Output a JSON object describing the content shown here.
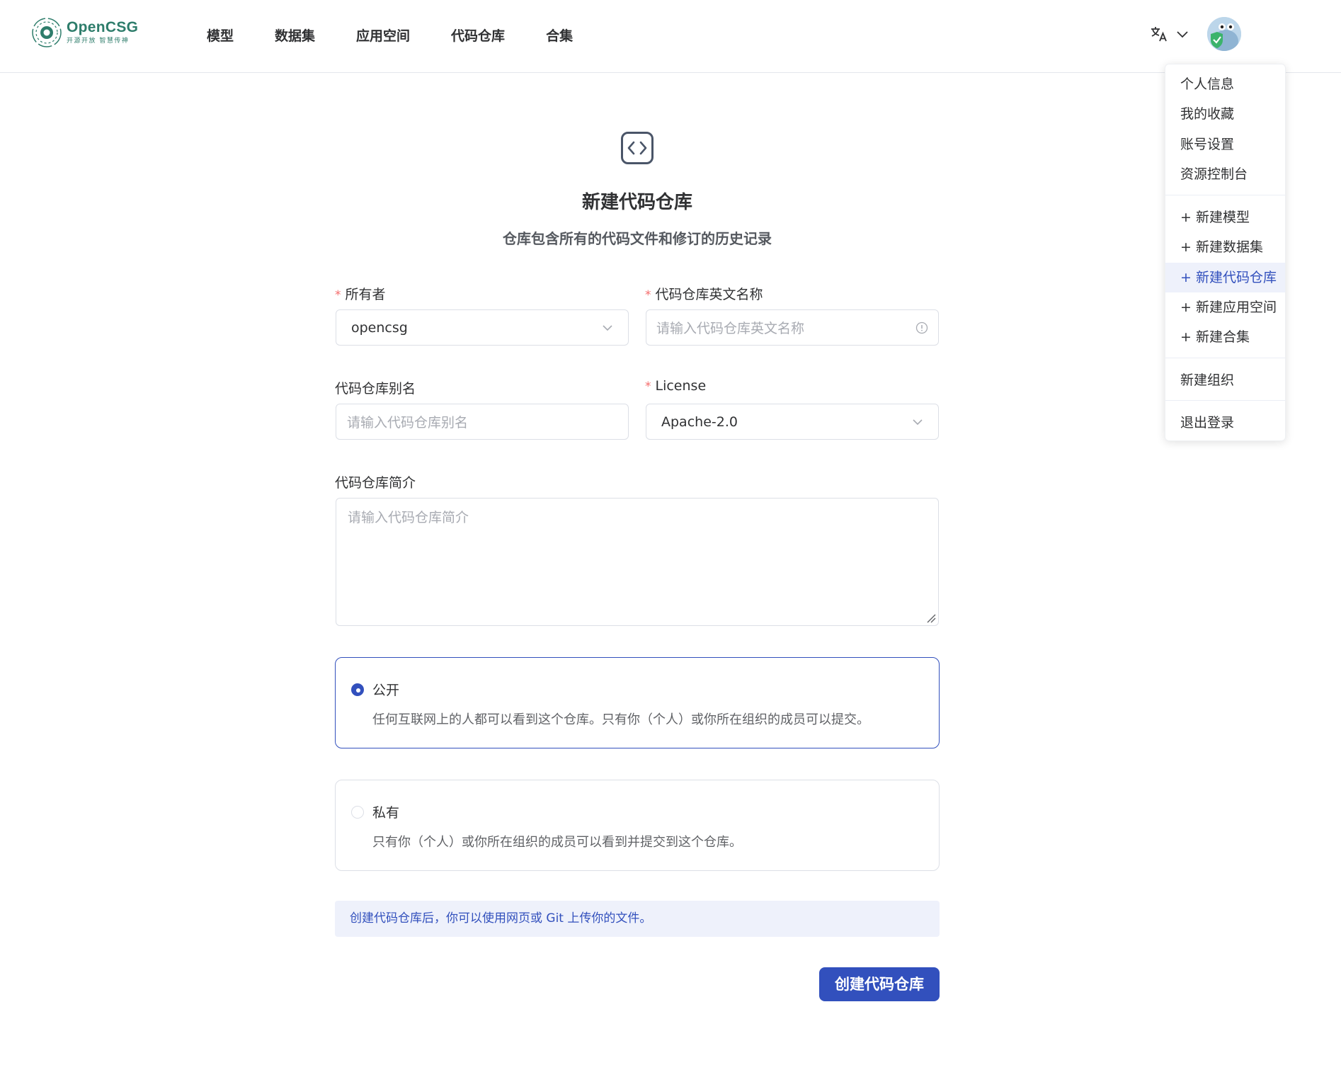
{
  "brand": {
    "name": "OpenCSG",
    "tagline": "开源开放 智慧传神",
    "accent": "#2e7d6b"
  },
  "nav": [
    {
      "label": "模型"
    },
    {
      "label": "数据集"
    },
    {
      "label": "应用空间"
    },
    {
      "label": "代码仓库"
    },
    {
      "label": "合集"
    }
  ],
  "header": {
    "language_icon": "translate-icon",
    "dropdown_icon": "chevron-down-icon",
    "avatar": "user-avatar"
  },
  "user_menu": {
    "group1": [
      {
        "label": "个人信息"
      },
      {
        "label": "我的收藏"
      },
      {
        "label": "账号设置"
      },
      {
        "label": "资源控制台"
      }
    ],
    "group2": [
      {
        "label": "+ 新建模型"
      },
      {
        "label": "+ 新建数据集"
      },
      {
        "label": "+ 新建代码仓库",
        "active": true
      },
      {
        "label": "+ 新建应用空间"
      },
      {
        "label": "+ 新建合集"
      }
    ],
    "group3": [
      {
        "label": "新建组织"
      }
    ],
    "group4": [
      {
        "label": "退出登录"
      }
    ]
  },
  "page": {
    "icon": "code-icon",
    "title": "新建代码仓库",
    "subtitle": "仓库包含所有的代码文件和修订的历史记录"
  },
  "form": {
    "owner": {
      "label": "所有者",
      "required": "*",
      "value": "opencsg"
    },
    "repo_name": {
      "label": "代码仓库英文名称",
      "required": "*",
      "placeholder": "请输入代码仓库英文名称"
    },
    "alias": {
      "label": "代码仓库别名",
      "placeholder": "请输入代码仓库别名"
    },
    "license": {
      "label": "License",
      "required": "*",
      "value": "Apache-2.0"
    },
    "description": {
      "label": "代码仓库简介",
      "placeholder": "请输入代码仓库简介"
    },
    "visibility": [
      {
        "title": "公开",
        "desc": "任何互联网上的人都可以看到这个仓库。只有你（个人）或你所在组织的成员可以提交。",
        "selected": true
      },
      {
        "title": "私有",
        "desc": "只有你（个人）或你所在组织的成员可以看到并提交到这个仓库。",
        "selected": false
      }
    ],
    "notice": "创建代码仓库后，你可以使用网页或 Git 上传你的文件。",
    "submit_label": "创建代码仓库"
  },
  "colors": {
    "primary": "#3250bd",
    "primary_light": "#eef1fb",
    "required": "#f56c6c",
    "border": "#dcdfe6"
  }
}
